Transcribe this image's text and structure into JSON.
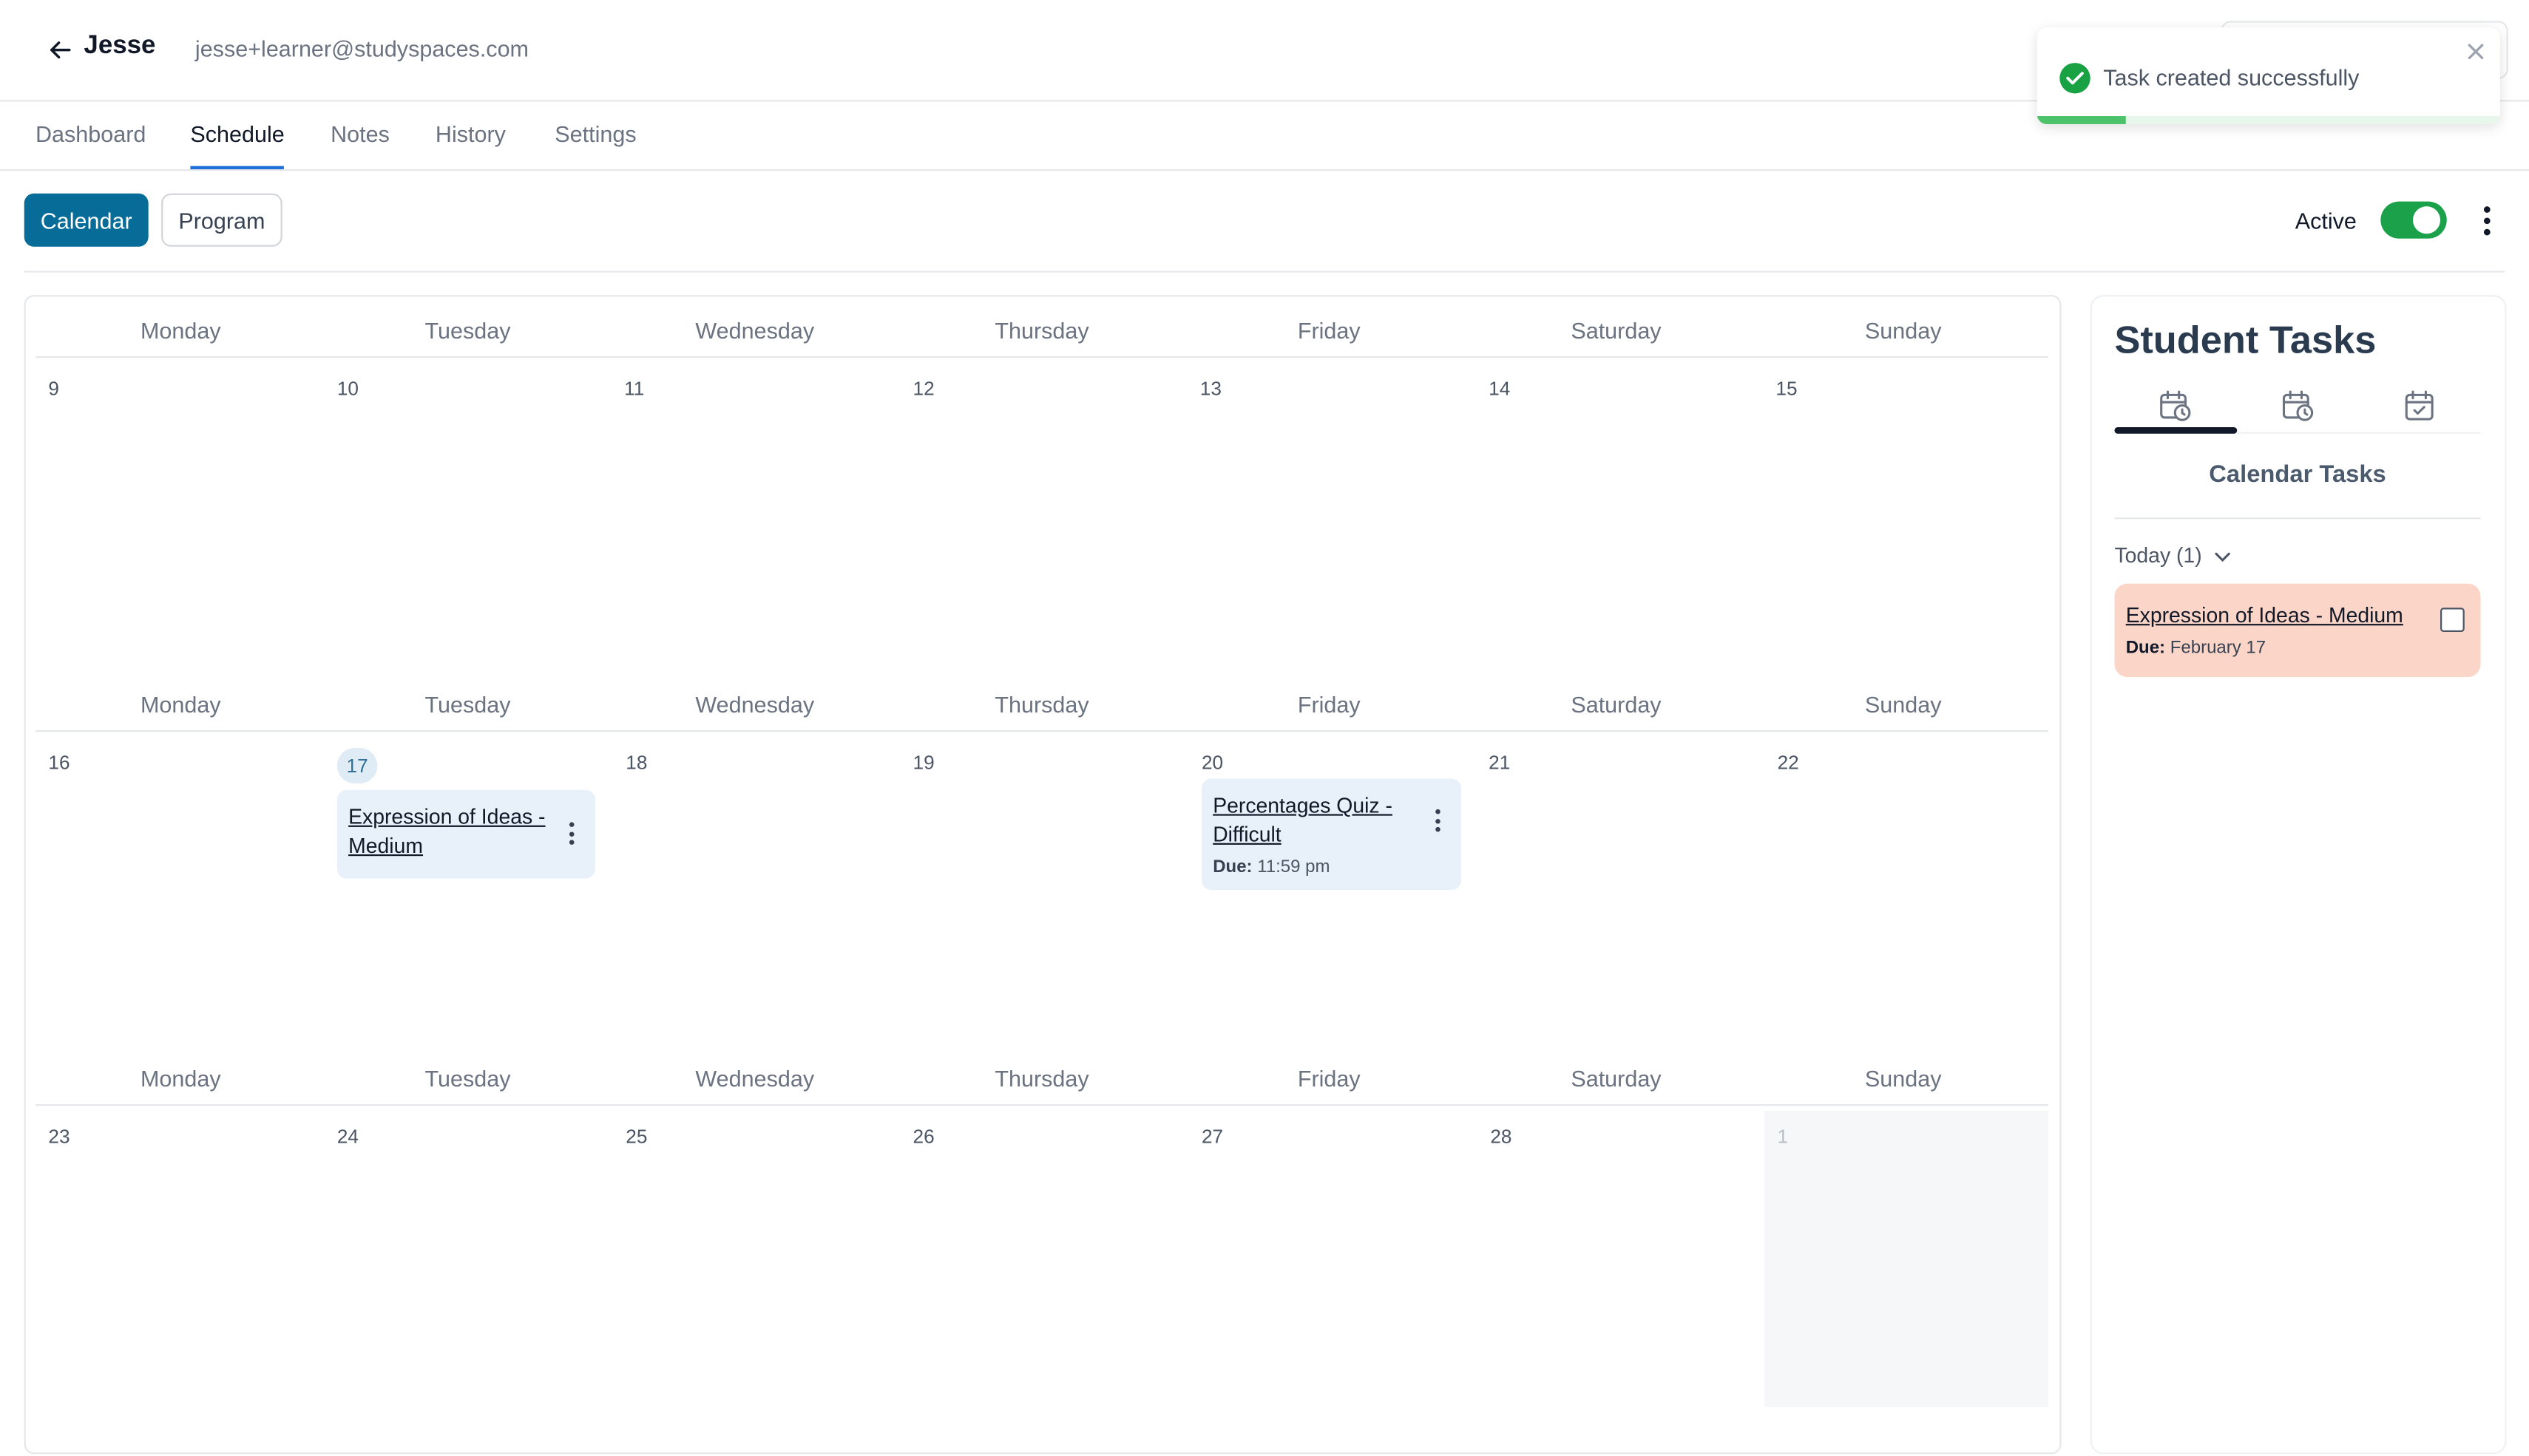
{
  "header": {
    "student_name": "Jesse",
    "student_email": "jesse+learner@studyspaces.com"
  },
  "tabs": [
    {
      "label": "Dashboard",
      "active": false
    },
    {
      "label": "Schedule",
      "active": true
    },
    {
      "label": "Notes",
      "active": false
    },
    {
      "label": "History",
      "active": false
    },
    {
      "label": "Settings",
      "active": false
    }
  ],
  "toolbar": {
    "calendar_label": "Calendar",
    "program_label": "Program",
    "active_label": "Active",
    "active_on": true
  },
  "calendar": {
    "weekdays": [
      "Monday",
      "Tuesday",
      "Wednesday",
      "Thursday",
      "Friday",
      "Saturday",
      "Sunday"
    ],
    "weeks": [
      {
        "days": [
          "9",
          "10",
          "11",
          "12",
          "13",
          "14",
          "15"
        ]
      },
      {
        "days": [
          "16",
          "17",
          "18",
          "19",
          "20",
          "21",
          "22"
        ]
      },
      {
        "days": [
          "23",
          "24",
          "25",
          "26",
          "27",
          "28",
          "1"
        ]
      }
    ],
    "today": "17",
    "events": [
      {
        "title": "Expression of Ideas - Medium",
        "day": "17"
      },
      {
        "title": "Percentages Quiz - Difficult",
        "day": "20",
        "due_label": "Due:",
        "due_value": "11:59 pm"
      }
    ]
  },
  "panel": {
    "title": "Student Tasks",
    "tab_icons": [
      "calendar-clock-icon",
      "calendar-clock-icon",
      "calendar-check-icon"
    ],
    "subtitle": "Calendar Tasks",
    "group_label": "Today (1)",
    "tasks": [
      {
        "title": "Expression of Ideas - Medium",
        "due_label": "Due:",
        "due_value": "February 17",
        "done": false
      }
    ]
  },
  "toast": {
    "message": "Task created successfully",
    "progress": 0.19
  },
  "colors": {
    "primary": "#076c98",
    "toggle_on": "#1aa14a",
    "event_bg": "#e8f1fa",
    "task_bg": "#fbd6c8",
    "success": "#18a243"
  }
}
